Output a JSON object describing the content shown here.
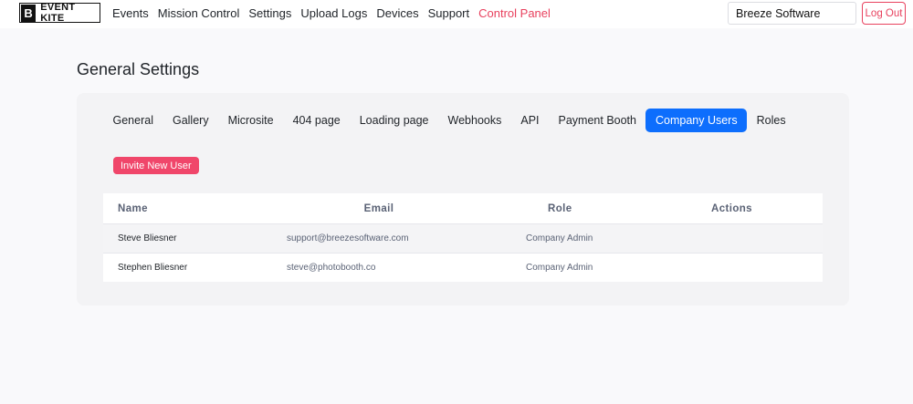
{
  "app": {
    "logo_mark": "B",
    "logo_text": "EVENT KITE"
  },
  "nav": {
    "items": [
      {
        "label": "Events",
        "active": false
      },
      {
        "label": "Mission Control",
        "active": false
      },
      {
        "label": "Settings",
        "active": false
      },
      {
        "label": "Upload Logs",
        "active": false
      },
      {
        "label": "Devices",
        "active": false
      },
      {
        "label": "Support",
        "active": false
      },
      {
        "label": "Control Panel",
        "active": true
      }
    ],
    "company_value": "Breeze Software",
    "logout_label": "Log Out"
  },
  "page": {
    "title": "General Settings"
  },
  "tabs": [
    {
      "label": "General",
      "active": false
    },
    {
      "label": "Gallery",
      "active": false
    },
    {
      "label": "Microsite",
      "active": false
    },
    {
      "label": "404 page",
      "active": false
    },
    {
      "label": "Loading page",
      "active": false
    },
    {
      "label": "Webhooks",
      "active": false
    },
    {
      "label": "API",
      "active": false
    },
    {
      "label": "Payment Booth",
      "active": false
    },
    {
      "label": "Company Users",
      "active": true
    },
    {
      "label": "Roles",
      "active": false
    }
  ],
  "users": {
    "invite_label": "Invite New User",
    "columns": [
      "Name",
      "Email",
      "Role",
      "Actions"
    ],
    "rows": [
      {
        "name": "Steve Bliesner",
        "email": "support@breezesoftware.com",
        "role": "Company Admin",
        "actions": ""
      },
      {
        "name": "Stephen Bliesner",
        "email": "steve@photobooth.co",
        "role": "Company Admin",
        "actions": ""
      }
    ]
  },
  "colors": {
    "accent": "#0d6efd",
    "danger": "#e8415e",
    "invite": "#f0466a"
  }
}
